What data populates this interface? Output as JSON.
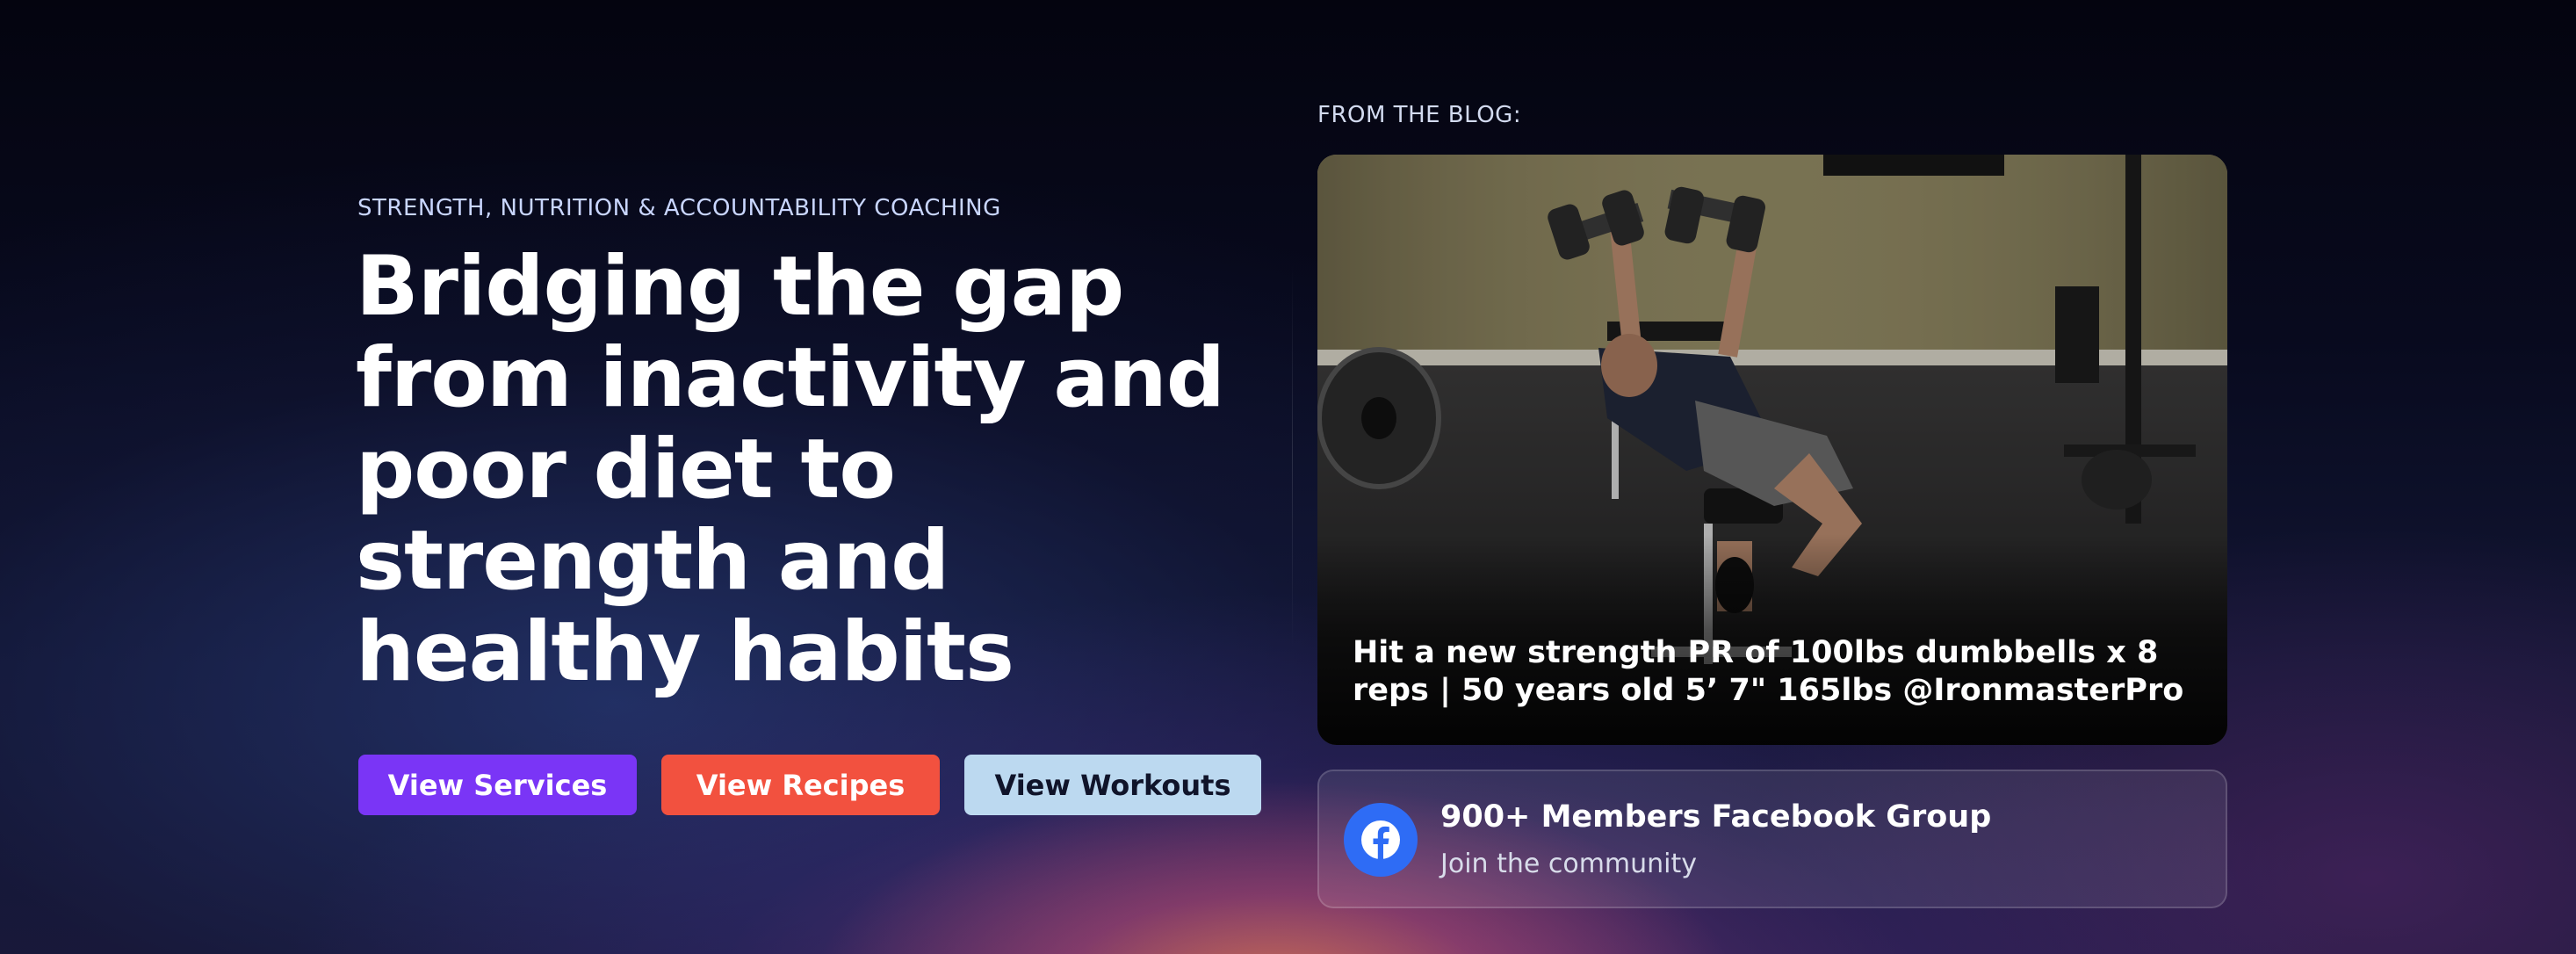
{
  "hero": {
    "kicker": "STRENGTH, NUTRITION & ACCOUNTABILITY COACHING",
    "headline": "Bridging the gap from inactivity and poor diet to strength and healthy habits",
    "buttons": {
      "services": "View Services",
      "recipes": "View Recipes",
      "workouts": "View Workouts"
    },
    "colors": {
      "services": "#7a35f6",
      "recipes": "#f2513f",
      "workouts": "#bcd9f0"
    }
  },
  "blog": {
    "label": "FROM THE BLOG:",
    "post_title": "Hit a new strength PR of 100lbs dumbbells x 8 reps | 50 years old 5’ 7\" 165lbs @IronmasterPro",
    "image_subject": "man doing incline dumbbell press in a home gym"
  },
  "community": {
    "title": "900+ Members Facebook Group",
    "subtitle": "Join the community",
    "icon": "facebook-icon",
    "icon_color": "#2e6cf5"
  }
}
